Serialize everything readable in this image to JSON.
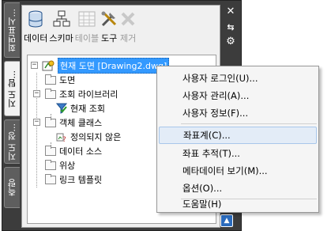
{
  "side_tabs": [
    {
      "label": "회면표시..."
    },
    {
      "label": "지도 탐..."
    },
    {
      "label": "지도 정..."
    },
    {
      "label": "측량"
    }
  ],
  "right_controls": {
    "close": "✕",
    "auto_hide": "⇆",
    "properties": "⚙"
  },
  "toolbar": {
    "data": "데이터",
    "schema": "스키마",
    "table": "테이블",
    "tools": "도구",
    "remove": "제거"
  },
  "tree": {
    "root": "현재 도면 [Drawing2.dwg]",
    "drawing": "도면",
    "query_library": "조회 라이브러리",
    "current_query": "현재 조회",
    "object_classes": "객체 클래스",
    "undefined": "정의되지 않은",
    "data_sources": "데이터 소스",
    "topology": "위상",
    "link_templates": "링크 템플릿"
  },
  "context_menu": {
    "user_login": "사용자 로그인(U)...",
    "user_admin": "사용자 관리(A)...",
    "user_info": "사용자 정보(F)...",
    "coord_system": "좌표계(C)...",
    "coord_track": "좌표 추적(T)...",
    "metadata_view": "메타데이터 보기(M)...",
    "options": "옵션(O)...",
    "help": "도움말(H)"
  },
  "colors": {
    "selection": "#3399ff",
    "frame": "#3c3c3c",
    "menu_highlight": "#e3ecf7"
  }
}
